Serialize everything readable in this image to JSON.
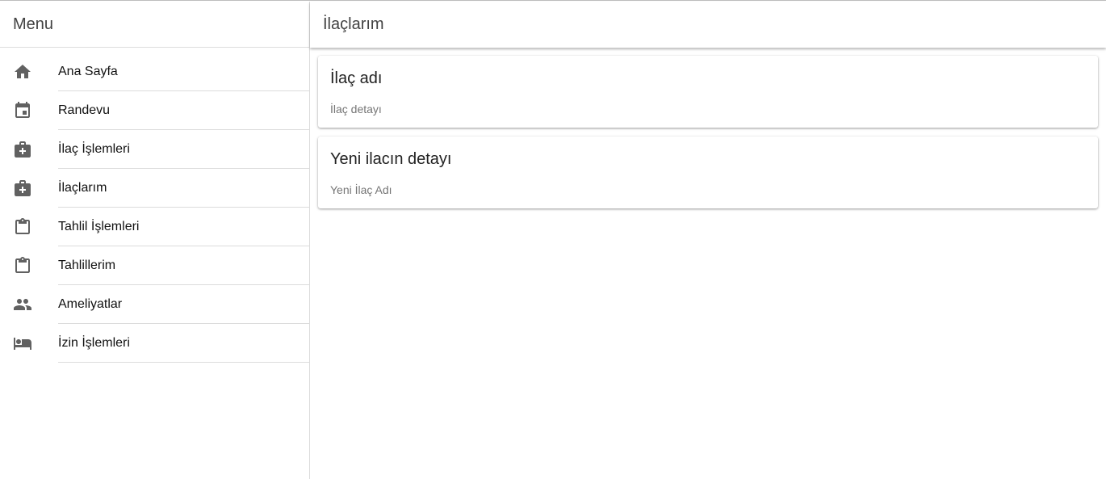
{
  "sidebar": {
    "title": "Menu",
    "items": [
      {
        "label": "Ana Sayfa",
        "icon": "home-icon"
      },
      {
        "label": "Randevu",
        "icon": "calendar-icon"
      },
      {
        "label": "İlaç İşlemleri",
        "icon": "medical-bag-icon"
      },
      {
        "label": "İlaçlarım",
        "icon": "medical-bag-icon"
      },
      {
        "label": "Tahlil İşlemleri",
        "icon": "clipboard-icon"
      },
      {
        "label": "Tahlillerim",
        "icon": "clipboard-icon"
      },
      {
        "label": "Ameliyatlar",
        "icon": "people-icon"
      },
      {
        "label": "İzin İşlemleri",
        "icon": "bed-icon"
      }
    ]
  },
  "main": {
    "title": "İlaçlarım",
    "cards": [
      {
        "title": "İlaç adı",
        "subtitle": "İlaç detayı"
      },
      {
        "title": "Yeni ilacın detayı",
        "subtitle": "Yeni İlaç Adı"
      }
    ]
  },
  "colors": {
    "icon": "#616161",
    "divider": "#dcdcdc",
    "header_text": "#424242"
  }
}
